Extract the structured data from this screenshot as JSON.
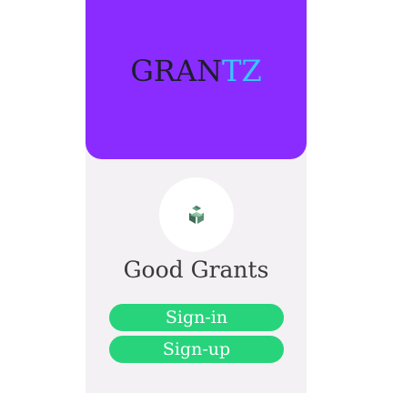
{
  "logo": {
    "part1": "GRAN",
    "part2": "TZ"
  },
  "app": {
    "title": "Good Grants",
    "icon": "gift-box-icon"
  },
  "buttons": {
    "signin_label": "Sign-in",
    "signup_label": "Sign-up"
  },
  "colors": {
    "hero_bg": "#8a2cff",
    "logo_dark": "#1d1d2e",
    "logo_accent": "#37c8ff",
    "button": "#27d47c",
    "panel_bg": "#f4f1f4"
  }
}
